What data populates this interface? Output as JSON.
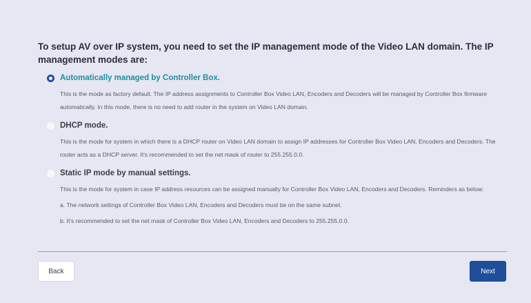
{
  "heading": "To setup AV over IP system, you need to set the IP management mode of the Video LAN domain. The IP management modes are:",
  "options": [
    {
      "title": "Automatically managed by Controller Box.",
      "selected": true,
      "lines": [
        "This is the mode as factory default. The IP address assignments to Controller Box Video LAN, Encoders and Decoders will be managed by Controller Box firmware automatically. In this mode, there is no need to add router in the system on Video LAN domain."
      ]
    },
    {
      "title": "DHCP mode.",
      "selected": false,
      "lines": [
        "This is the mode for system in which there is a DHCP router on Video LAN domain to assign IP addresses for Controller Box Video LAN, Encoders and Decoders. The router acts as a DHCP server. It's recommended to set the net mask of router to 255.255.0.0."
      ]
    },
    {
      "title": "Static IP mode by manual settings.",
      "selected": false,
      "lines": [
        "This is the mode for system in case IP address resources can be assigned manually for Controller Box Video LAN, Encoders and Decoders. Reminders as below:",
        "a. The network settings of Controller Box Video LAN, Encoders and Decoders must be on the same subnet.",
        "b. It's recommended to set the net mask of Controller Box Video LAN, Encoders and Decoders to 255.255.0.0."
      ]
    }
  ],
  "buttons": {
    "back": "Back",
    "next": "Next"
  },
  "colors": {
    "background": "#e6e7f2",
    "accent": "#1d4f9a",
    "selected_title": "#1f8fa0"
  }
}
